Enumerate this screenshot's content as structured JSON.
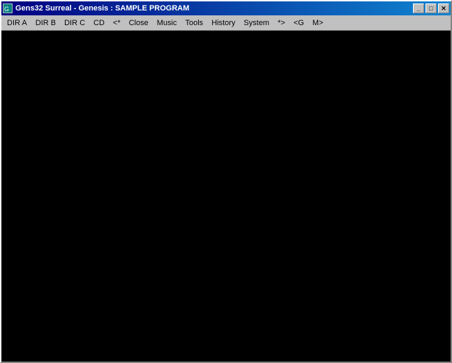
{
  "window": {
    "title": "Gens32 Surreal - Genesis : SAMPLE PROGRAM"
  },
  "titleButtons": {
    "minimize": "_",
    "maximize": "□",
    "close": "✕"
  },
  "menuItems": [
    {
      "id": "dir-a",
      "label": "DIR A"
    },
    {
      "id": "dir-b",
      "label": "DIR B"
    },
    {
      "id": "dir-c",
      "label": "DIR C"
    },
    {
      "id": "cd",
      "label": "CD"
    },
    {
      "id": "nav-back",
      "label": "<*"
    },
    {
      "id": "close",
      "label": "Close"
    },
    {
      "id": "music",
      "label": "Music"
    },
    {
      "id": "tools",
      "label": "Tools"
    },
    {
      "id": "history",
      "label": "History"
    },
    {
      "id": "system",
      "label": "System"
    },
    {
      "id": "nav-forward",
      "label": "*>"
    },
    {
      "id": "g-shortcut",
      "label": "<G"
    },
    {
      "id": "m-shortcut",
      "label": "M>"
    }
  ]
}
